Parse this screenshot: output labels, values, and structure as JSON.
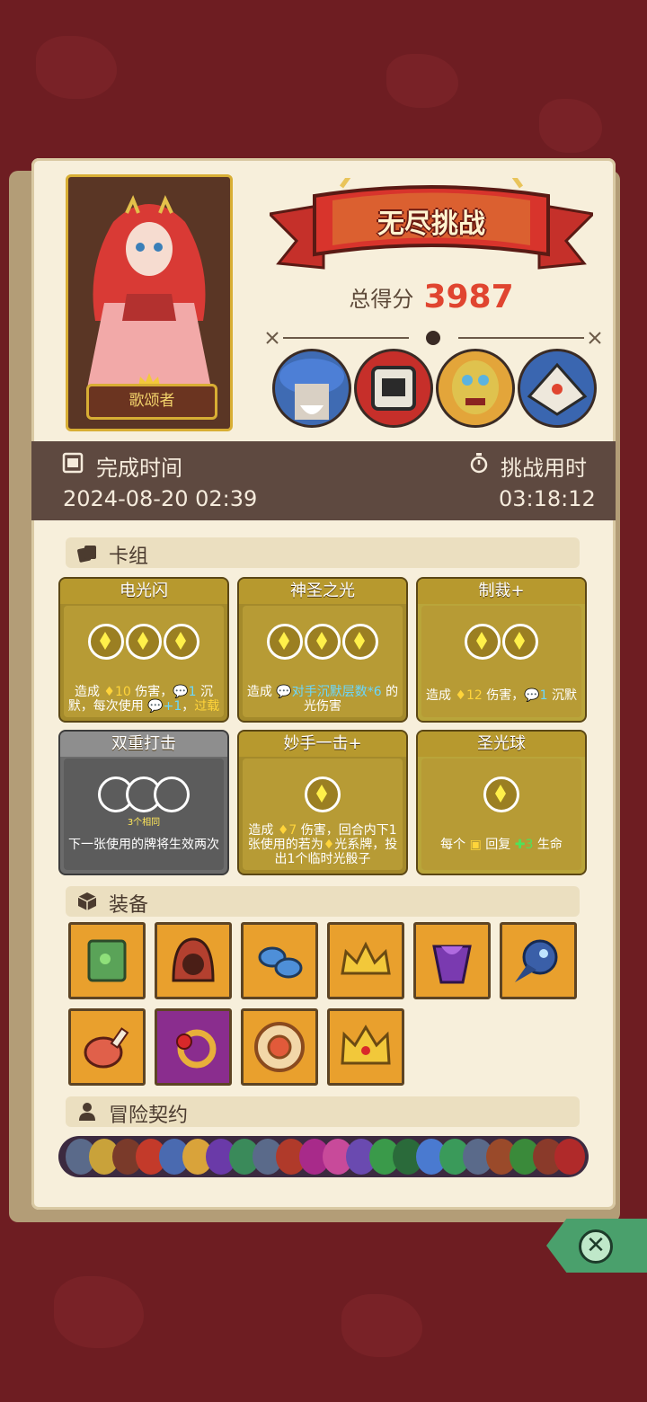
{
  "hero": {
    "name": "歌颂者"
  },
  "banner": {
    "title": "无尽挑战"
  },
  "score": {
    "label": "总得分",
    "value": "3987"
  },
  "bosses": [
    "mushroom-elder-portrait",
    "drum-knight-portrait",
    "masked-shaman-portrait",
    "bone-dragon-portrait"
  ],
  "time": {
    "finish_label": "完成时间",
    "finish_value": "2024-08-20 02:39",
    "duration_label": "挑战用时",
    "duration_value": "03:18:12"
  },
  "sections": {
    "deck": "卡组",
    "equipment": "装备",
    "contract": "冒险契约"
  },
  "cards": [
    {
      "name": "电光闪",
      "gems": 3,
      "desc_parts": [
        "造成 ",
        "♦10",
        " 伤害，",
        "💬1",
        " 沉默，每次使用 ",
        "💬+1",
        "，",
        "过载"
      ]
    },
    {
      "name": "神圣之光",
      "gems": 3,
      "desc_parts": [
        "造成 ",
        "💬对手沉默层数*6",
        " 的光伤害"
      ]
    },
    {
      "name": "制裁+",
      "gems": 2,
      "desc_parts": [
        "造成 ",
        "♦12",
        " 伤害，",
        "💬1",
        " 沉默"
      ]
    },
    {
      "name": "双重打击",
      "gems": 3,
      "note": "3个相同",
      "desc": "下一张使用的牌将生效两次"
    },
    {
      "name": "妙手一击+",
      "gems": 1,
      "desc_parts": [
        "造成 ",
        "♦7",
        " 伤害，回合内下1张使用的若为",
        "♦",
        "光系牌，投出1个临时光骰子"
      ]
    },
    {
      "name": "圣光球",
      "gems": 1,
      "desc_parts": [
        "每个 ",
        "▣",
        " 回复 ",
        "✚3",
        " 生命"
      ]
    }
  ],
  "equipment": [
    "green-book-icon",
    "red-hood-icon",
    "blue-mushroom-icon",
    "gold-tiara-icon",
    "purple-cloak-icon",
    "plague-mask-icon",
    "ham-leg-icon",
    "ruby-ring-icon",
    "round-shield-icon",
    "jeweled-crown-icon"
  ],
  "colors": {
    "accent_red": "#e04530",
    "panel": "#f7efdb",
    "card_gold": "#b79b35",
    "highlight_blue": "#6ad8ff"
  }
}
